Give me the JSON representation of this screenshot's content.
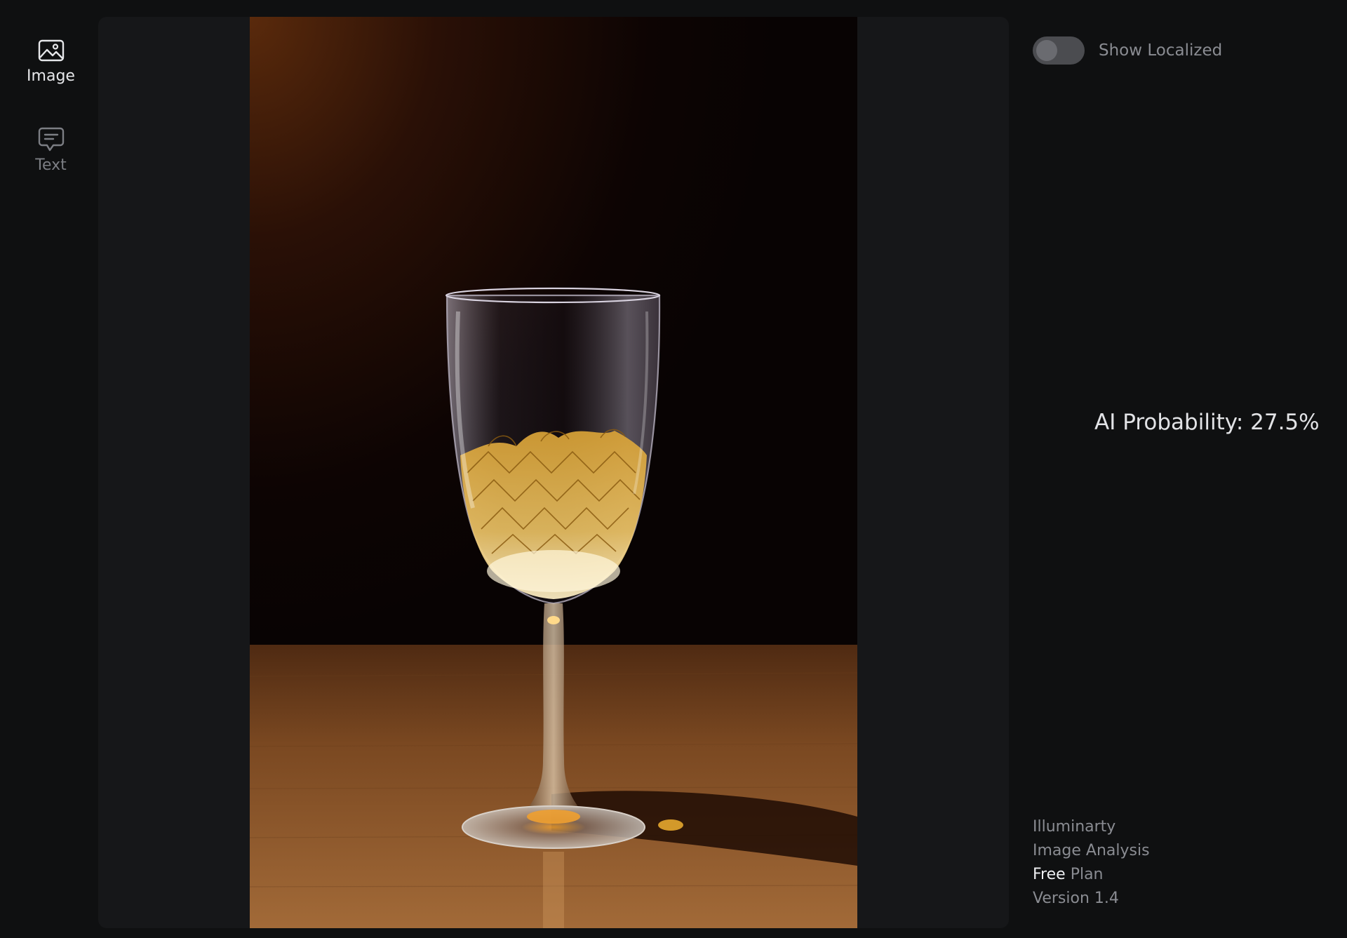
{
  "nav": {
    "items": [
      {
        "label": "Image",
        "icon": "image-icon",
        "active": true
      },
      {
        "label": "Text",
        "icon": "message-icon",
        "active": false
      }
    ]
  },
  "controls": {
    "show_localized_label": "Show Localized",
    "show_localized_on": false
  },
  "result": {
    "probability_text": "AI Probability: 27.5%",
    "probability_value": 27.5
  },
  "footer": {
    "brand": "Illuminarty",
    "product": "Image Analysis",
    "plan_tier": "Free",
    "plan_suffix": "Plan",
    "version": "Version 1.4"
  },
  "colors": {
    "background": "#0f1011",
    "panel": "#161719",
    "accent_text": "#e6e7ea",
    "muted_text": "#8a8c92"
  }
}
